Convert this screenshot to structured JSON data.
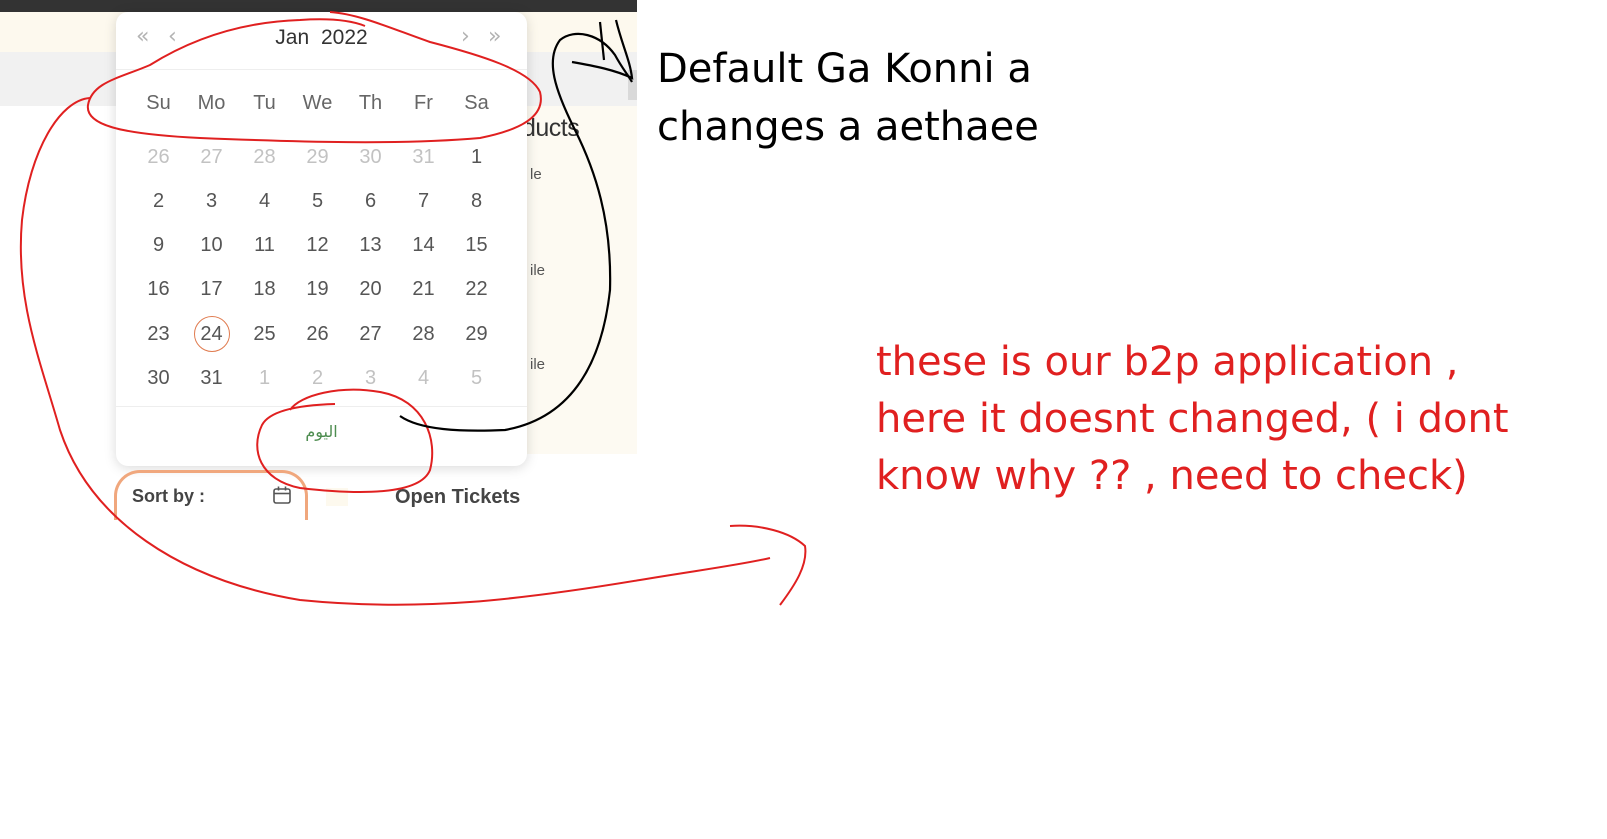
{
  "app": {
    "background_heading": "ducts",
    "background_cells": [
      "le",
      "ile",
      "ile"
    ],
    "sort_label": "Sort by :",
    "open_tickets": "Open Tickets"
  },
  "calendar": {
    "nav": {
      "prev_year": "«",
      "prev_month": "‹",
      "next_month": "›",
      "next_year": "»"
    },
    "month": "Jan",
    "year": "2022",
    "weekdays": [
      "Su",
      "Mo",
      "Tu",
      "We",
      "Th",
      "Fr",
      "Sa"
    ],
    "weeks": [
      [
        "26",
        "27",
        "28",
        "29",
        "30",
        "31",
        "1"
      ],
      [
        "2",
        "3",
        "4",
        "5",
        "6",
        "7",
        "8"
      ],
      [
        "9",
        "10",
        "11",
        "12",
        "13",
        "14",
        "15"
      ],
      [
        "16",
        "17",
        "18",
        "19",
        "20",
        "21",
        "22"
      ],
      [
        "23",
        "24",
        "25",
        "26",
        "27",
        "28",
        "29"
      ],
      [
        "30",
        "31",
        "1",
        "2",
        "3",
        "4",
        "5"
      ]
    ],
    "selected_day": "24",
    "today_label": "اليوم"
  },
  "annotations": {
    "black_note": [
      "Default Ga Konni a",
      "changes a aethaee"
    ],
    "red_note": [
      "these is our b2p application ,",
      "here it doesnt changed, ( i dont",
      "know why ?? , need to check)"
    ],
    "colors": {
      "red": "#e02020",
      "black": "#000000",
      "accent": "#e07b4f",
      "today_link": "#4e8d50"
    }
  }
}
